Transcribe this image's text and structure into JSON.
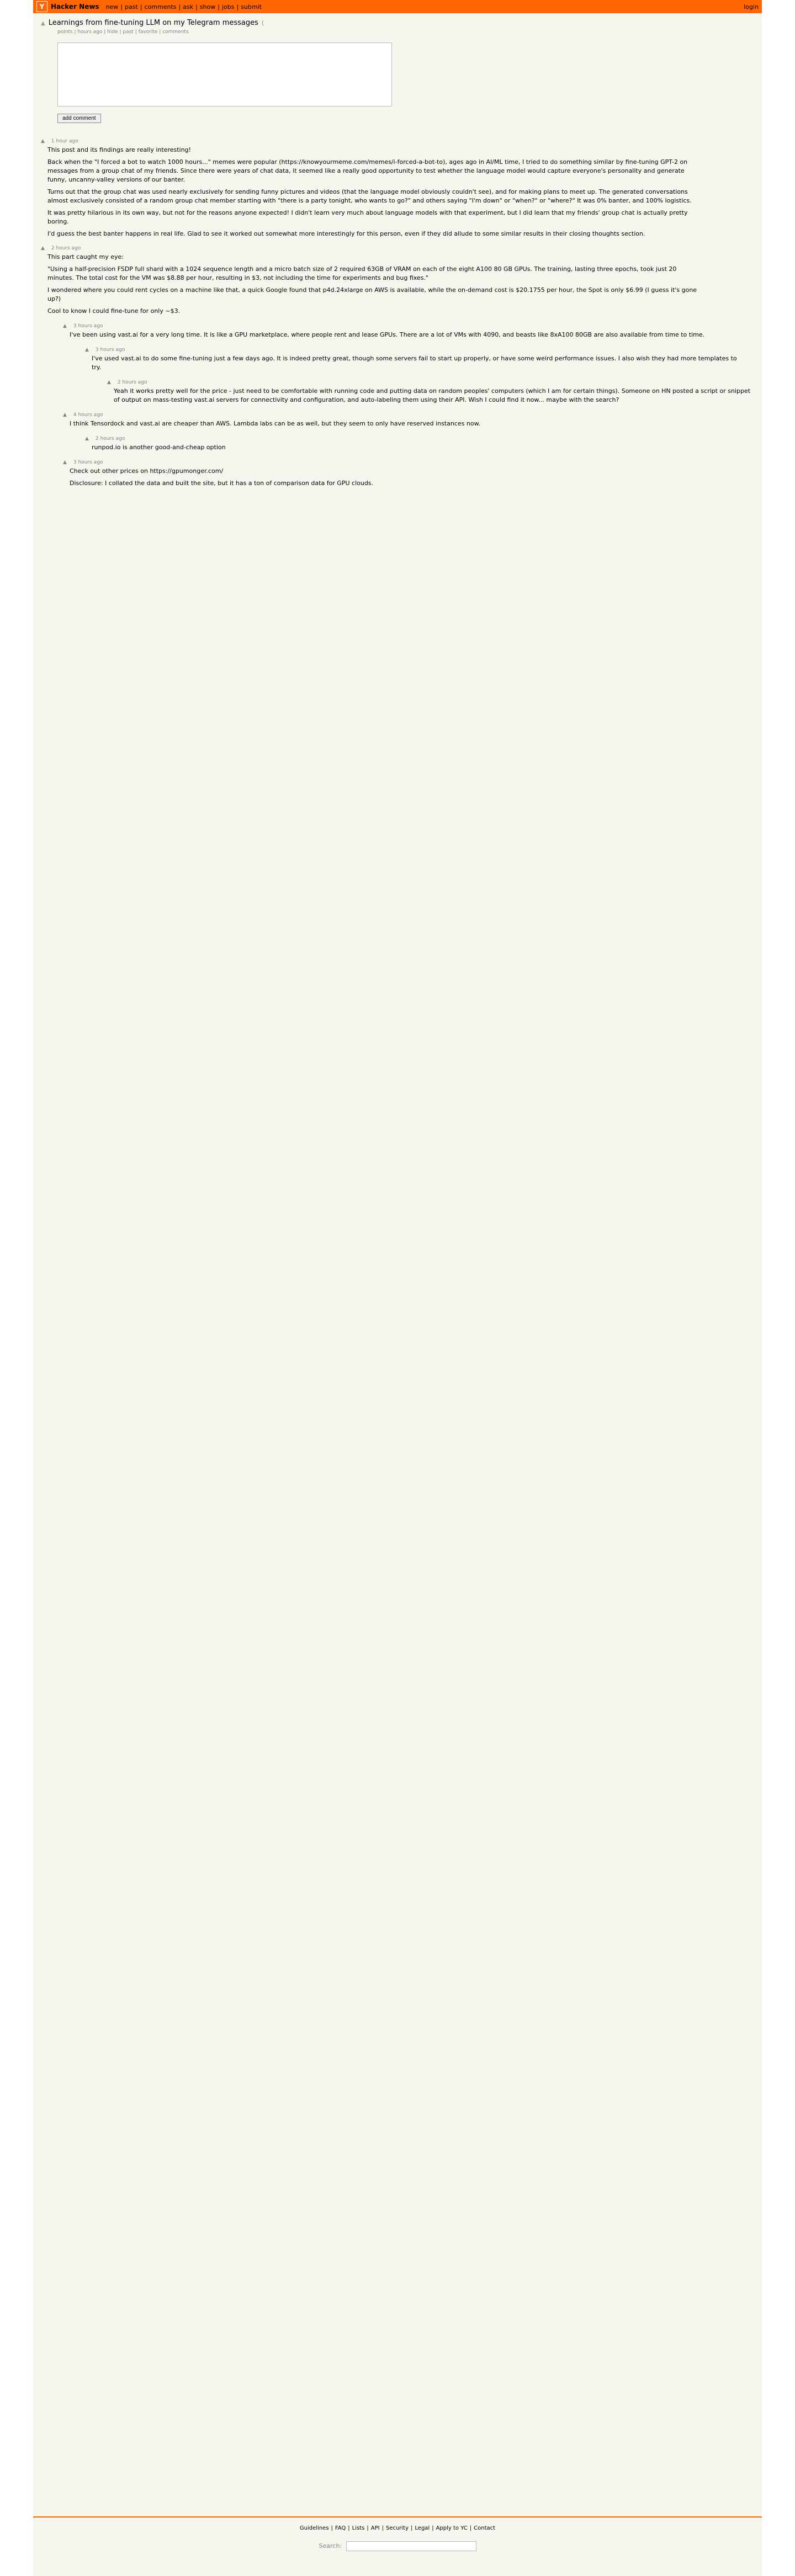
{
  "header": {
    "logo": "Y",
    "site_name": "Hacker News",
    "nav": [
      "new",
      "past",
      "comments",
      "ask",
      "show",
      "jobs",
      "submit"
    ],
    "login": "login"
  },
  "story": {
    "vote_icon": "upvote-arrow-icon",
    "title": "Learnings from fine-tuning LLM on my Telegram messages",
    "domain": "(",
    "subtext": [
      "points",
      "hours ago",
      "hide",
      "past",
      "favorite",
      "comments"
    ]
  },
  "reply": {
    "button": "add comment"
  },
  "comments": [
    {
      "user": "",
      "age": "1 hour ago",
      "body": [
        "This post and its findings are really interesting!",
        "Back when the \"I forced a bot to watch 1000 hours...\" memes were popular (https://knowyourmeme.com/memes/i-forced-a-bot-to), ages ago in AI/ML time, I tried to do something similar by fine-tuning GPT-2 on messages from a group chat of my friends. Since there were years of chat data, it seemed like a really good opportunity to test whether the language model would capture everyone's personality and generate funny, uncanny-valley versions of our banter.",
        "Turns out that the group chat was used nearly exclusively for sending funny pictures and videos (that the language model obviously couldn't see), and for making plans to meet up. The generated conversations almost exclusively consisted of a random group chat member starting with \"there is a party tonight, who wants to go?\" and others saying \"I'm down\" or \"when?\" or \"where?\" It was 0% banter, and 100% logistics.",
        "It was pretty hilarious in its own way, but not for the reasons anyone expected! I didn't learn very much about language models with that experiment, but I did learn that my friends' group chat is actually pretty boring.",
        "I'd guess the best banter happens in real life. Glad to see it worked out somewhat more interestingly for this person, even if they did allude to some similar results in their closing thoughts section."
      ]
    },
    {
      "user": "",
      "age": "2 hours ago",
      "body": [
        "This part caught my eye:",
        "\"Using a half-precision FSDP full shard with a 1024 sequence length and a micro batch size of 2 required 63GB of VRAM on each of the eight A100 80 GB GPUs. The training, lasting three epochs, took just 20 minutes. The total cost for the VM was $8.88 per hour, resulting in $3, not including the time for experiments and bug fixes.\"",
        "I wondered where you could rent cycles on a machine like that, a quick Google found that p4d.24xlarge on AWS is available, while the on-demand cost is $20.1755 per hour, the Spot is only $6.99 (I guess it's gone up?)",
        "Cool to know I could fine-tune for only ~$3."
      ]
    },
    {
      "user": "",
      "age": "3 hours ago",
      "body": [
        "I've been using vast.ai for a very long time. It is like a GPU marketplace, where people rent and lease GPUs. There are a lot of VMs with 4090, and beasts like 8xA100 80GB are also available from time to time."
      ]
    },
    {
      "user": "",
      "age": "3 hours ago",
      "body": [
        "I've used vast.ai to do some fine-tuning just a few days ago. It is indeed pretty great, though some servers fail to start up properly, or have some weird performance issues. I also wish they had more templates to try."
      ]
    },
    {
      "user": "",
      "age": "2 hours ago",
      "body": [
        "Yeah it works pretty well for the price - just need to be comfortable with running code and putting data on random peoples' computers (which I am for certain things). Someone on HN posted a script or snippet of output on mass-testing vast.ai servers for connectivity and configuration, and auto-labeling them using their API. Wish I could find it now... maybe with the search?"
      ]
    },
    {
      "user": "",
      "age": "4 hours ago",
      "body": [
        "I think Tensordock and vast.ai are cheaper than AWS. Lambda labs can be as well, but they seem to only have reserved instances now."
      ]
    },
    {
      "user": "",
      "age": "2 hours ago",
      "body": [
        "runpod.io is another good-and-cheap option"
      ]
    },
    {
      "user": "",
      "age": "3 hours ago",
      "body": [
        "Check out other prices on https://gpumonger.com/",
        "Disclosure: I collated the data and built the site, but it has a ton of comparison data for GPU clouds."
      ]
    }
  ],
  "footer": {
    "links": [
      "Guidelines",
      "FAQ",
      "Lists",
      "API",
      "Security",
      "Legal",
      "Apply to YC",
      "Contact"
    ],
    "search_label": "Search:"
  }
}
